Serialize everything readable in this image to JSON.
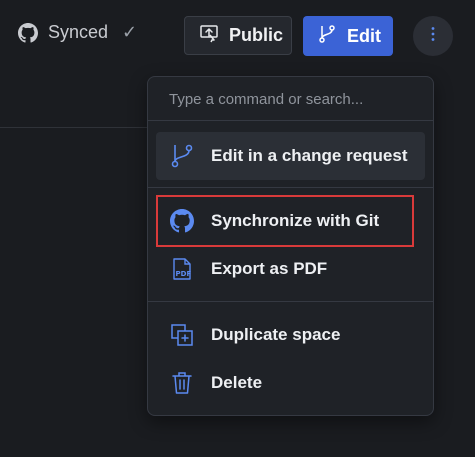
{
  "header": {
    "sync_status": "Synced",
    "public_label": "Public",
    "edit_label": "Edit"
  },
  "menu": {
    "search_placeholder": "Type a command or search...",
    "items": [
      {
        "label": "Edit in a change request",
        "icon": "branch-icon"
      },
      {
        "label": "Synchronize with Git",
        "icon": "github-icon"
      },
      {
        "label": "Export as PDF",
        "icon": "pdf-icon"
      },
      {
        "label": "Duplicate space",
        "icon": "duplicate-icon"
      },
      {
        "label": "Delete",
        "icon": "trash-icon"
      }
    ]
  },
  "colors": {
    "accent": "#3b63d6",
    "highlight": "#d93a3a",
    "icon_blue": "#5b8af0",
    "background": "#1a1c20"
  }
}
